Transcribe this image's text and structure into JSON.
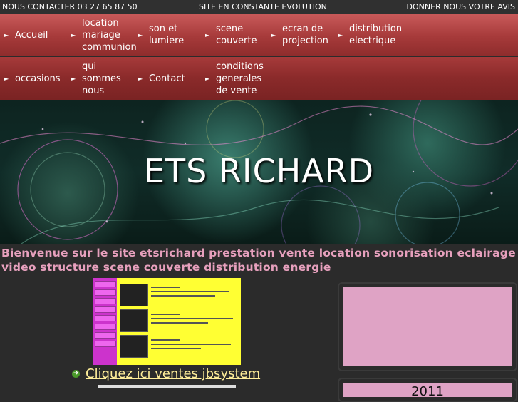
{
  "topbar": {
    "contact": "NOUS CONTACTER 03 27 65 87 50",
    "tagline": "SITE EN CONSTANTE EVOLUTION",
    "feedback": "DONNER NOUS VOTRE AVIS"
  },
  "nav": {
    "row1": [
      {
        "label": "Accueil"
      },
      {
        "label": "location\nmariage\ncommunion"
      },
      {
        "label": "son et\nlumiere"
      },
      {
        "label": "scene\ncouverte"
      },
      {
        "label": "ecran de\nprojection"
      },
      {
        "label": "distribution\nelectrique"
      }
    ],
    "row2": [
      {
        "label": "occasions"
      },
      {
        "label": "qui\nsommes\nnous"
      },
      {
        "label": "Contact"
      },
      {
        "label": "conditions\ngenerales\nde vente"
      }
    ],
    "arrow": "►"
  },
  "banner": {
    "title": "ETS RICHARD"
  },
  "welcome": {
    "text": "Bienvenue sur le site  etsrichard  prestation vente location sonorisation eclairage  video structure scene couverte distribution energie"
  },
  "cta": {
    "icon": "arrow-circle-icon",
    "glyph": "➜",
    "label": "Cliquez ici  ventes jbsystem"
  },
  "sidebar": {
    "box2_text": "2011"
  },
  "colors": {
    "nav": "#a63a3a",
    "welcome_text": "#e7a0bd",
    "link": "#ffee99",
    "side_fill": "#dfa3c5"
  }
}
